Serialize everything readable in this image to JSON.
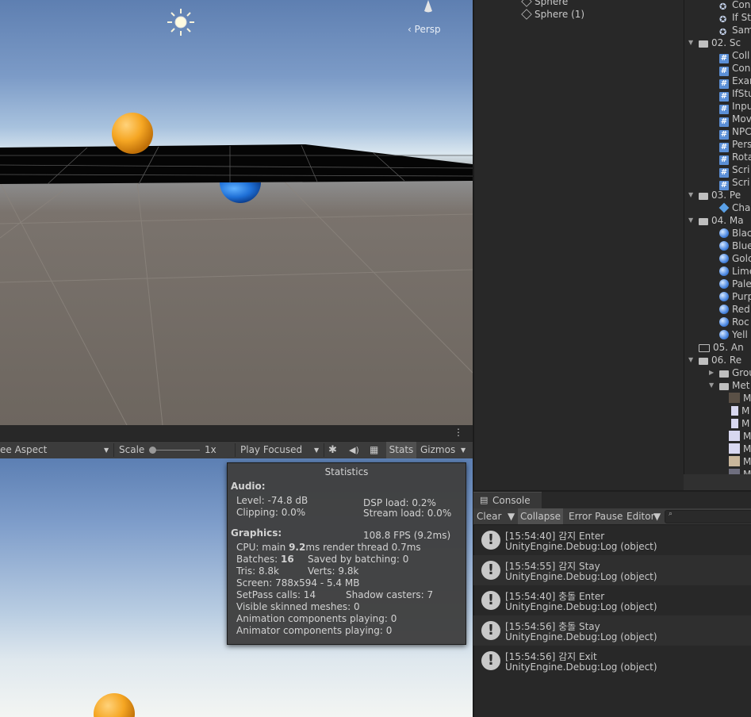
{
  "scene": {
    "projection_label": "Persp",
    "icons": [
      "sun-icon",
      "perspective-gizmo-icon"
    ]
  },
  "game_toolbar": {
    "aspect": "ee Aspect",
    "scale_label": "Scale",
    "scale_value": "1x",
    "play_mode": "Play Focused",
    "stats_label": "Stats",
    "gizmos_label": "Gizmos"
  },
  "statistics": {
    "title": "Statistics",
    "audio_heading": "Audio:",
    "level": "Level: -74.8 dB",
    "clipping": "Clipping: 0.0%",
    "dsp_load": "DSP load: 0.2%",
    "stream_load": "Stream load: 0.0%",
    "graphics_heading": "Graphics:",
    "fps": "108.8 FPS (9.2ms)",
    "cpu_prefix": "CPU: main ",
    "cpu_main": "9.2",
    "cpu_suffix": "ms  render thread 0.7ms",
    "batches_prefix": "Batches: ",
    "batches": "16",
    "saved_by_batching": "Saved by batching: 0",
    "tris": "Tris: 8.8k",
    "verts": "Verts: 9.8k",
    "screen": "Screen: 788x594 - 5.4 MB",
    "setpass": "SetPass calls: 14",
    "shadow_casters": "Shadow casters: 7",
    "skinned": "Visible skinned meshes: 0",
    "anim_components": "Animation components playing: 0",
    "animator_components": "Animator components playing: 0"
  },
  "hierarchy": {
    "items": [
      "Sphere",
      "Sphere (1)"
    ]
  },
  "project": {
    "rows": [
      {
        "label": "Con",
        "icon": "unity-icon",
        "indent": 1
      },
      {
        "label": "If St",
        "icon": "unity-icon",
        "indent": 1
      },
      {
        "label": "Sam",
        "icon": "unity-icon",
        "indent": 1
      },
      {
        "label": "02. Sc",
        "icon": "folder-open-icon",
        "indent": 0
      },
      {
        "label": "Coll",
        "icon": "script-icon",
        "indent": 1
      },
      {
        "label": "Con",
        "icon": "script-icon",
        "indent": 1
      },
      {
        "label": "Exar",
        "icon": "script-icon",
        "indent": 1
      },
      {
        "label": "IfStu",
        "icon": "script-icon",
        "indent": 1
      },
      {
        "label": "Inpu",
        "icon": "script-icon",
        "indent": 1
      },
      {
        "label": "Mov",
        "icon": "script-icon",
        "indent": 1
      },
      {
        "label": "NPC",
        "icon": "script-icon",
        "indent": 1
      },
      {
        "label": "Pers",
        "icon": "script-icon",
        "indent": 1
      },
      {
        "label": "Rota",
        "icon": "script-icon",
        "indent": 1
      },
      {
        "label": "Scri",
        "icon": "script-icon",
        "indent": 1
      },
      {
        "label": "Scri",
        "icon": "script-icon",
        "indent": 1
      },
      {
        "label": "03. Pe",
        "icon": "folder-open-icon",
        "indent": 0
      },
      {
        "label": "Cha",
        "icon": "prefab-icon",
        "indent": 1
      },
      {
        "label": "04. Ma",
        "icon": "folder-open-icon",
        "indent": 0
      },
      {
        "label": "Blac",
        "icon": "material-icon",
        "indent": 1
      },
      {
        "label": "Blue",
        "icon": "material-icon",
        "indent": 1
      },
      {
        "label": "Golc",
        "icon": "material-icon",
        "indent": 1
      },
      {
        "label": "Lime",
        "icon": "material-icon",
        "indent": 1
      },
      {
        "label": "Pale",
        "icon": "material-icon",
        "indent": 1
      },
      {
        "label": "Purp",
        "icon": "material-icon",
        "indent": 1
      },
      {
        "label": "Red",
        "icon": "material-icon",
        "indent": 1
      },
      {
        "label": "Roc",
        "icon": "material-icon",
        "indent": 1
      },
      {
        "label": "Yell",
        "icon": "material-icon",
        "indent": 1
      },
      {
        "label": "05. An",
        "icon": "folder-icon",
        "indent": 0
      },
      {
        "label": "06. Re",
        "icon": "folder-open-icon",
        "indent": 0
      },
      {
        "label": "Grou",
        "icon": "folder-icon",
        "indent": 1
      },
      {
        "label": "Met",
        "icon": "folder-open-icon",
        "indent": 1
      },
      {
        "label": "M",
        "icon": "texture-icon",
        "indent": 2
      },
      {
        "label": "M",
        "icon": "file-icon",
        "indent": 2
      },
      {
        "label": "M",
        "icon": "file-icon",
        "indent": 2
      },
      {
        "label": "M",
        "icon": "texture-icon",
        "indent": 2
      },
      {
        "label": "M",
        "icon": "texture-icon",
        "indent": 2
      },
      {
        "label": "M",
        "icon": "texture-icon",
        "indent": 2
      },
      {
        "label": "M",
        "icon": "texture-icon",
        "indent": 2
      }
    ]
  },
  "console": {
    "tab": "Console",
    "clear": "Clear",
    "collapse": "Collapse",
    "error_pause": "Error Pause",
    "editor": "Editor",
    "logs": [
      {
        "line1": "[15:54:40] 감지 Enter",
        "line2": "UnityEngine.Debug:Log (object)"
      },
      {
        "line1": "[15:54:55] 감지 Stay",
        "line2": "UnityEngine.Debug:Log (object)"
      },
      {
        "line1": "[15:54:40] 충돌 Enter",
        "line2": "UnityEngine.Debug:Log (object)"
      },
      {
        "line1": "[15:54:56] 충돌 Stay",
        "line2": "UnityEngine.Debug:Log (object)"
      },
      {
        "line1": "[15:54:56] 감지 Exit",
        "line2": "UnityEngine.Debug:Log (object)"
      }
    ]
  }
}
